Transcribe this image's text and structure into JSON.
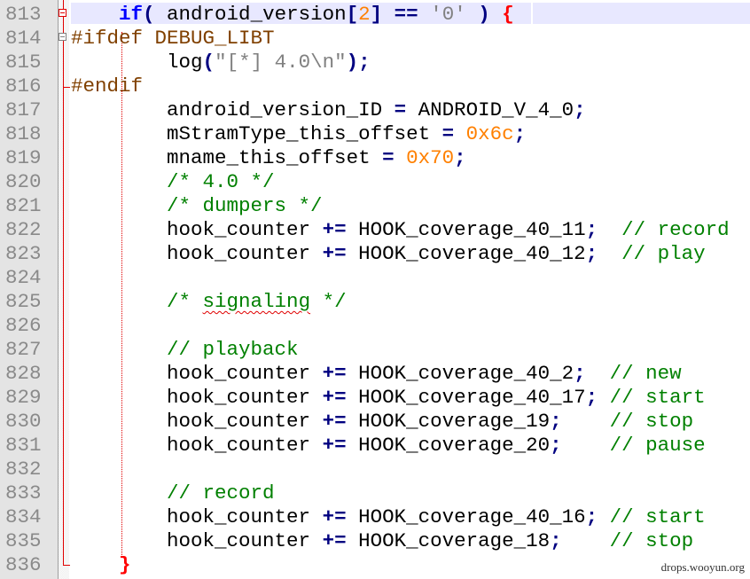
{
  "editor": {
    "lines": [
      {
        "num": "813",
        "indent": "    ",
        "tokens": [
          {
            "t": "if",
            "c": "kw"
          },
          {
            "t": "(",
            "c": "op"
          },
          {
            "t": " android_version",
            "c": ""
          },
          {
            "t": "[",
            "c": "op"
          },
          {
            "t": "2",
            "c": "num"
          },
          {
            "t": "]",
            "c": "op"
          },
          {
            "t": " ",
            "c": ""
          },
          {
            "t": "==",
            "c": "op"
          },
          {
            "t": " ",
            "c": ""
          },
          {
            "t": "'0'",
            "c": "str"
          },
          {
            "t": " ",
            "c": ""
          },
          {
            "t": ")",
            "c": "op"
          },
          {
            "t": " ",
            "c": ""
          },
          {
            "t": "{",
            "c": "brace"
          }
        ]
      },
      {
        "num": "814",
        "indent": "",
        "tokens": [
          {
            "t": "#ifdef DEBUG_LIBT",
            "c": "pre"
          }
        ]
      },
      {
        "num": "815",
        "indent": "        ",
        "tokens": [
          {
            "t": "log",
            "c": ""
          },
          {
            "t": "(",
            "c": "op"
          },
          {
            "t": "\"[*] 4.0\\n\"",
            "c": "str"
          },
          {
            "t": ");",
            "c": "op"
          }
        ]
      },
      {
        "num": "816",
        "indent": "",
        "tokens": [
          {
            "t": "#endif",
            "c": "pre"
          }
        ]
      },
      {
        "num": "817",
        "indent": "        ",
        "tokens": [
          {
            "t": "android_version_ID ",
            "c": ""
          },
          {
            "t": "=",
            "c": "op"
          },
          {
            "t": " ANDROID_V_4_0",
            "c": ""
          },
          {
            "t": ";",
            "c": "op"
          }
        ]
      },
      {
        "num": "818",
        "indent": "        ",
        "tokens": [
          {
            "t": "mStramType_this_offset ",
            "c": ""
          },
          {
            "t": "=",
            "c": "op"
          },
          {
            "t": " ",
            "c": ""
          },
          {
            "t": "0x6c",
            "c": "num"
          },
          {
            "t": ";",
            "c": "op"
          }
        ]
      },
      {
        "num": "819",
        "indent": "        ",
        "tokens": [
          {
            "t": "mname_this_offset ",
            "c": ""
          },
          {
            "t": "=",
            "c": "op"
          },
          {
            "t": " ",
            "c": ""
          },
          {
            "t": "0x70",
            "c": "num"
          },
          {
            "t": ";",
            "c": "op"
          }
        ]
      },
      {
        "num": "820",
        "indent": "        ",
        "tokens": [
          {
            "t": "/* 4.0 */",
            "c": "cmt"
          }
        ]
      },
      {
        "num": "821",
        "indent": "        ",
        "tokens": [
          {
            "t": "/* dumpers */",
            "c": "cmt"
          }
        ]
      },
      {
        "num": "822",
        "indent": "        ",
        "tokens": [
          {
            "t": "hook_counter ",
            "c": ""
          },
          {
            "t": "+=",
            "c": "op"
          },
          {
            "t": " HOOK_coverage_40_11",
            "c": ""
          },
          {
            "t": ";",
            "c": "op"
          },
          {
            "t": "  ",
            "c": ""
          },
          {
            "t": "// record",
            "c": "cmt"
          }
        ]
      },
      {
        "num": "823",
        "indent": "        ",
        "tokens": [
          {
            "t": "hook_counter ",
            "c": ""
          },
          {
            "t": "+=",
            "c": "op"
          },
          {
            "t": " HOOK_coverage_40_12",
            "c": ""
          },
          {
            "t": ";",
            "c": "op"
          },
          {
            "t": "  ",
            "c": ""
          },
          {
            "t": "// play",
            "c": "cmt"
          }
        ]
      },
      {
        "num": "824",
        "indent": "",
        "tokens": []
      },
      {
        "num": "825",
        "indent": "        ",
        "tokens": [
          {
            "t": "/* ",
            "c": "cmt"
          },
          {
            "t": "signaling",
            "c": "cmt squiggle"
          },
          {
            "t": " */",
            "c": "cmt"
          }
        ]
      },
      {
        "num": "826",
        "indent": "",
        "tokens": []
      },
      {
        "num": "827",
        "indent": "        ",
        "tokens": [
          {
            "t": "// playback",
            "c": "cmt"
          }
        ]
      },
      {
        "num": "828",
        "indent": "        ",
        "tokens": [
          {
            "t": "hook_counter ",
            "c": ""
          },
          {
            "t": "+=",
            "c": "op"
          },
          {
            "t": " HOOK_coverage_40_2",
            "c": ""
          },
          {
            "t": ";",
            "c": "op"
          },
          {
            "t": "  ",
            "c": ""
          },
          {
            "t": "// new",
            "c": "cmt"
          }
        ]
      },
      {
        "num": "829",
        "indent": "        ",
        "tokens": [
          {
            "t": "hook_counter ",
            "c": ""
          },
          {
            "t": "+=",
            "c": "op"
          },
          {
            "t": " HOOK_coverage_40_17",
            "c": ""
          },
          {
            "t": ";",
            "c": "op"
          },
          {
            "t": " ",
            "c": ""
          },
          {
            "t": "// start",
            "c": "cmt"
          }
        ]
      },
      {
        "num": "830",
        "indent": "        ",
        "tokens": [
          {
            "t": "hook_counter ",
            "c": ""
          },
          {
            "t": "+=",
            "c": "op"
          },
          {
            "t": " HOOK_coverage_19",
            "c": ""
          },
          {
            "t": ";",
            "c": "op"
          },
          {
            "t": "    ",
            "c": ""
          },
          {
            "t": "// stop",
            "c": "cmt"
          }
        ]
      },
      {
        "num": "831",
        "indent": "        ",
        "tokens": [
          {
            "t": "hook_counter ",
            "c": ""
          },
          {
            "t": "+=",
            "c": "op"
          },
          {
            "t": " HOOK_coverage_20",
            "c": ""
          },
          {
            "t": ";",
            "c": "op"
          },
          {
            "t": "    ",
            "c": ""
          },
          {
            "t": "// pause",
            "c": "cmt"
          }
        ]
      },
      {
        "num": "832",
        "indent": "",
        "tokens": []
      },
      {
        "num": "833",
        "indent": "        ",
        "tokens": [
          {
            "t": "// record",
            "c": "cmt"
          }
        ]
      },
      {
        "num": "834",
        "indent": "        ",
        "tokens": [
          {
            "t": "hook_counter ",
            "c": ""
          },
          {
            "t": "+=",
            "c": "op"
          },
          {
            "t": " HOOK_coverage_40_16",
            "c": ""
          },
          {
            "t": ";",
            "c": "op"
          },
          {
            "t": " ",
            "c": ""
          },
          {
            "t": "// start",
            "c": "cmt"
          }
        ]
      },
      {
        "num": "835",
        "indent": "        ",
        "tokens": [
          {
            "t": "hook_counter ",
            "c": ""
          },
          {
            "t": "+=",
            "c": "op"
          },
          {
            "t": " HOOK_coverage_18",
            "c": ""
          },
          {
            "t": ";",
            "c": "op"
          },
          {
            "t": "    ",
            "c": ""
          },
          {
            "t": "// stop",
            "c": "cmt"
          }
        ]
      },
      {
        "num": "836",
        "indent": "    ",
        "tokens": [
          {
            "t": "}",
            "c": "brace"
          }
        ]
      }
    ]
  },
  "watermark": "drops.wooyun.org",
  "colors": {
    "keyword": "#0000ff",
    "operator": "#000080",
    "number": "#ff8000",
    "string": "#808080",
    "preprocessor": "#804000",
    "comment": "#008000",
    "brace_match": "#ff0000",
    "current_line": "#e8e8ff",
    "line_number": "#8a8a8a"
  }
}
